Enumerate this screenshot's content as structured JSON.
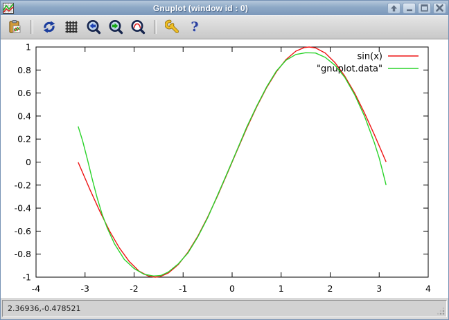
{
  "window": {
    "title": "Gnuplot (window id : 0)"
  },
  "toolbar": {
    "buttons": [
      {
        "name": "copy-plot-to-clipboard"
      },
      {
        "name": "replot"
      },
      {
        "name": "toggle-grid"
      },
      {
        "name": "zoom-previous"
      },
      {
        "name": "zoom-next"
      },
      {
        "name": "autoscale"
      },
      {
        "name": "options"
      },
      {
        "name": "help"
      }
    ],
    "help_glyph": "?"
  },
  "statusbar": {
    "coordinates": "2.36936,-0.478521"
  },
  "chart_data": {
    "type": "line",
    "title": "",
    "xlabel": "",
    "ylabel": "",
    "xlim": [
      -4,
      4
    ],
    "ylim": [
      -1,
      1
    ],
    "grid": false,
    "legend_position": "top-right-inside",
    "xticks": [
      -4,
      -3,
      -2,
      -1,
      0,
      1,
      2,
      3,
      4
    ],
    "xtick_labels": [
      "-4",
      "-3",
      "-2",
      "-1",
      "0",
      "1",
      "2",
      "3",
      "4"
    ],
    "yticks": [
      -1,
      -0.8,
      -0.6,
      -0.4,
      -0.2,
      0,
      0.2,
      0.4,
      0.6,
      0.8,
      1
    ],
    "ytick_labels": [
      "-1",
      "-0.8",
      "-0.6",
      "-0.4",
      "-0.2",
      "0",
      "0.2",
      "0.4",
      "0.6",
      "0.8",
      "1"
    ],
    "axis_color": "#000000",
    "series": [
      {
        "id": "sin-curve",
        "name": "sin(x)",
        "color": "#ee1515",
        "points": [
          [
            -3.14,
            -0.002
          ],
          [
            -2.9,
            -0.239
          ],
          [
            -2.7,
            -0.427
          ],
          [
            -2.5,
            -0.599
          ],
          [
            -2.3,
            -0.746
          ],
          [
            -2.1,
            -0.863
          ],
          [
            -1.9,
            -0.947
          ],
          [
            -1.7,
            -0.992
          ],
          [
            -1.57,
            -1.0
          ],
          [
            -1.47,
            -0.995
          ],
          [
            -1.3,
            -0.964
          ],
          [
            -1.1,
            -0.891
          ],
          [
            -0.9,
            -0.783
          ],
          [
            -0.7,
            -0.644
          ],
          [
            -0.5,
            -0.479
          ],
          [
            -0.3,
            -0.296
          ],
          [
            -0.1,
            -0.1
          ],
          [
            0.1,
            0.1
          ],
          [
            0.3,
            0.296
          ],
          [
            0.5,
            0.479
          ],
          [
            0.7,
            0.644
          ],
          [
            0.9,
            0.783
          ],
          [
            1.1,
            0.891
          ],
          [
            1.3,
            0.964
          ],
          [
            1.47,
            0.995
          ],
          [
            1.57,
            1.0
          ],
          [
            1.7,
            0.992
          ],
          [
            1.9,
            0.947
          ],
          [
            2.1,
            0.863
          ],
          [
            2.3,
            0.746
          ],
          [
            2.5,
            0.599
          ],
          [
            2.7,
            0.427
          ],
          [
            2.9,
            0.239
          ],
          [
            3.14,
            0.002
          ]
        ]
      },
      {
        "id": "gnuplot-data-curve",
        "name": "\"gnuplot.data\"",
        "color": "#2ad32a",
        "points": [
          [
            -3.14,
            0.31
          ],
          [
            -3.05,
            0.185
          ],
          [
            -2.95,
            0.02
          ],
          [
            -2.85,
            -0.155
          ],
          [
            -2.75,
            -0.315
          ],
          [
            -2.65,
            -0.455
          ],
          [
            -2.55,
            -0.57
          ],
          [
            -2.4,
            -0.71
          ],
          [
            -2.2,
            -0.845
          ],
          [
            -2.0,
            -0.925
          ],
          [
            -1.8,
            -0.975
          ],
          [
            -1.6,
            -0.99
          ],
          [
            -1.45,
            -0.985
          ],
          [
            -1.3,
            -0.955
          ],
          [
            -1.1,
            -0.885
          ],
          [
            -0.9,
            -0.79
          ],
          [
            -0.7,
            -0.65
          ],
          [
            -0.5,
            -0.485
          ],
          [
            -0.3,
            -0.29
          ],
          [
            -0.1,
            -0.095
          ],
          [
            0.1,
            0.105
          ],
          [
            0.3,
            0.305
          ],
          [
            0.5,
            0.485
          ],
          [
            0.7,
            0.65
          ],
          [
            0.9,
            0.79
          ],
          [
            1.1,
            0.885
          ],
          [
            1.3,
            0.935
          ],
          [
            1.5,
            0.95
          ],
          [
            1.7,
            0.948
          ],
          [
            1.9,
            0.91
          ],
          [
            2.1,
            0.84
          ],
          [
            2.3,
            0.735
          ],
          [
            2.5,
            0.585
          ],
          [
            2.7,
            0.4
          ],
          [
            2.9,
            0.17
          ],
          [
            3.0,
            0.035
          ],
          [
            3.07,
            -0.08
          ],
          [
            3.14,
            -0.2
          ]
        ]
      }
    ]
  }
}
